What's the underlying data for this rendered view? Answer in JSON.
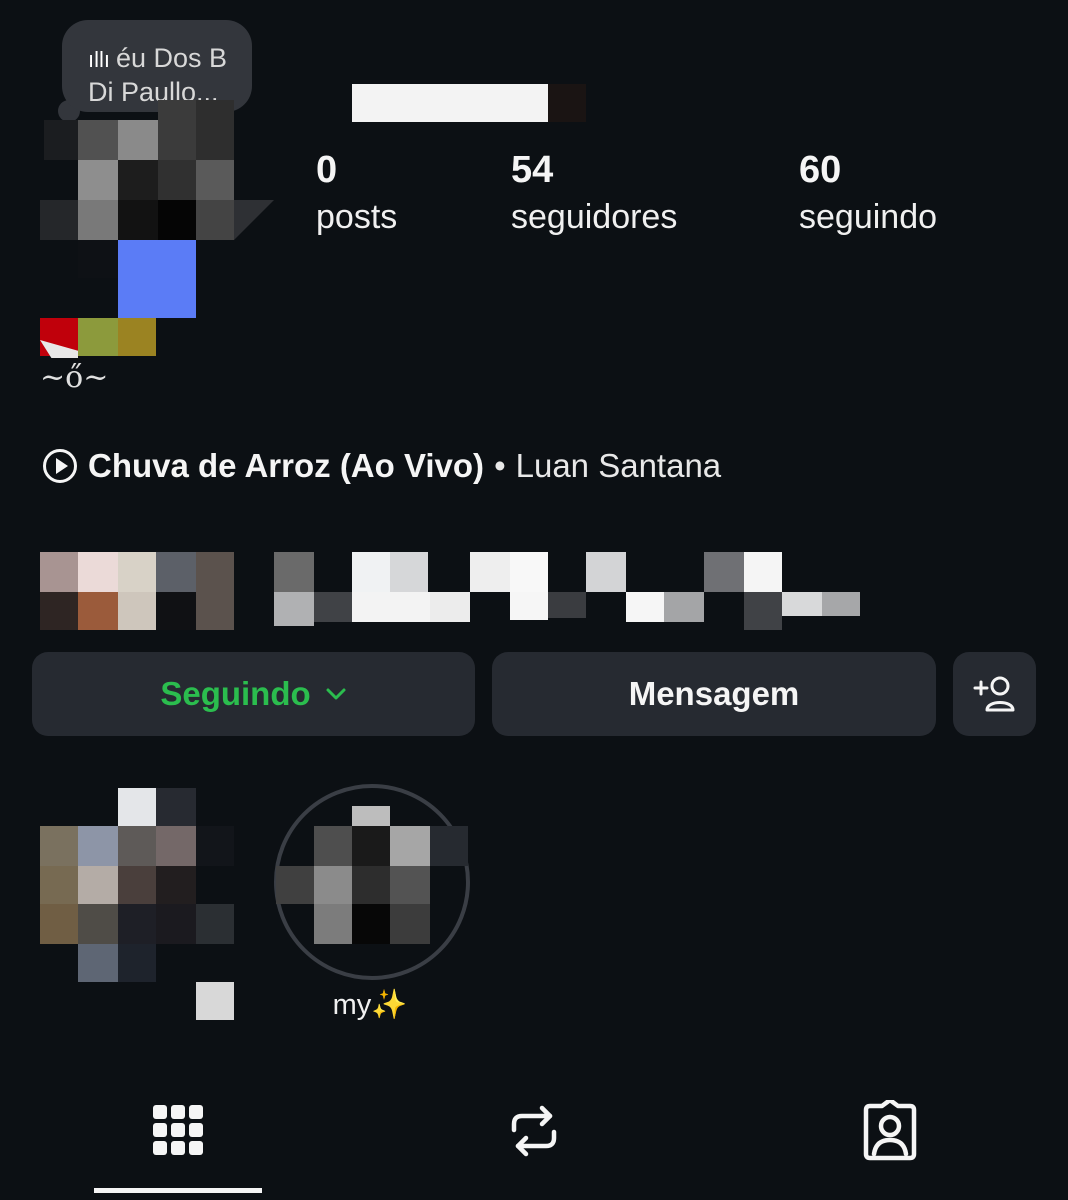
{
  "note": {
    "line1": "éu Dos B",
    "line2": "Di Paullo..."
  },
  "profile": {
    "tag_text": "~ő~"
  },
  "stats": {
    "posts": {
      "count": "0",
      "label": "posts"
    },
    "followers": {
      "count": "54",
      "label": "seguidores"
    },
    "following": {
      "count": "60",
      "label": "seguindo"
    }
  },
  "music": {
    "title": "Chuva de Arroz (Ao Vivo)",
    "separator": "•",
    "artist": "Luan Santana"
  },
  "actions": {
    "following_label": "Seguindo",
    "message_label": "Mensagem"
  },
  "highlights": [
    {
      "label": "my✨"
    }
  ],
  "tabs": [
    {
      "icon": "grid-icon",
      "active": true
    },
    {
      "icon": "reels-repost-icon",
      "active": false
    },
    {
      "icon": "tagged-icon",
      "active": false
    }
  ],
  "colors": {
    "background": "#0c1014",
    "button_bg": "#262a31",
    "following_green": "#2bbd4e"
  }
}
